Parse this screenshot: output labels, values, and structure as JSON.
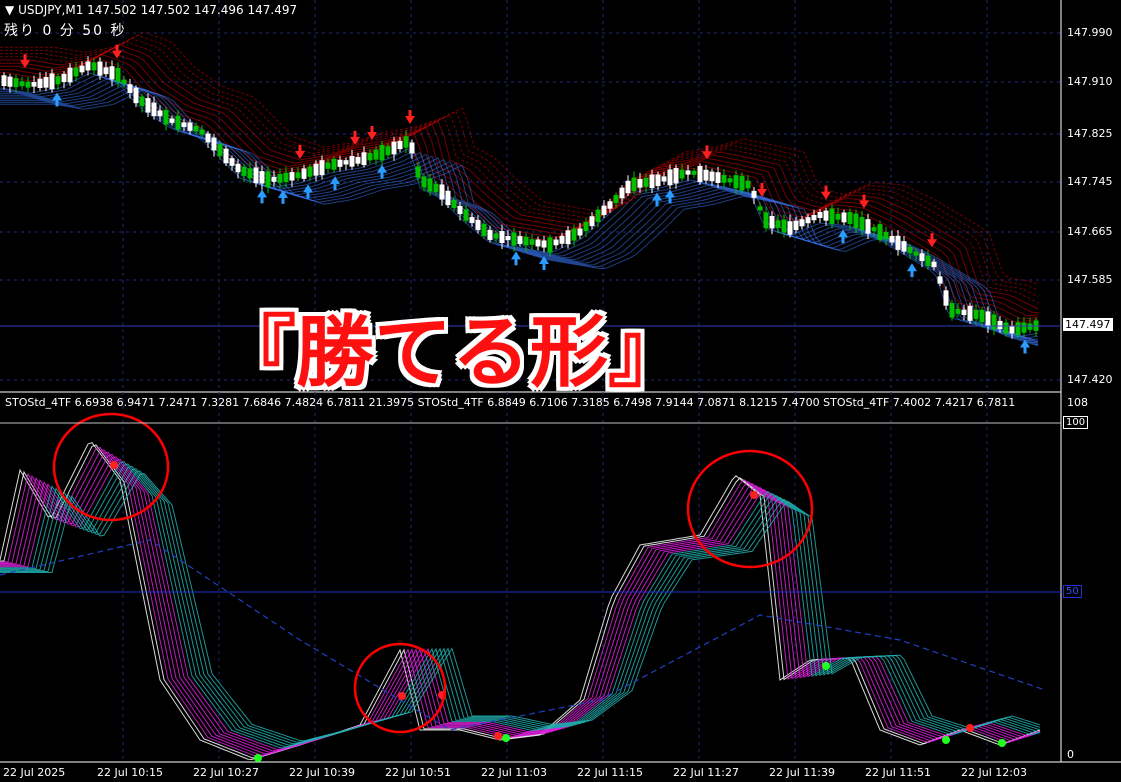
{
  "header": {
    "symbol_line": "USDJPY,M1  147.502 147.502 147.496 147.497",
    "countdown": "残り 0 分 50 秒"
  },
  "overlay": {
    "title": "『勝てる形』"
  },
  "indicator": {
    "header": "STOStd_4TF 6.6938 6.9471 7.2471 7.3281 7.6846 7.4824 6.7811 21.3975  STOStd_4TF 6.8849 6.7106 7.3185 6.7498 7.9144 7.0871 8.1215 7.4700  STOStd_4TF 7.4002 7.4217 6.7811",
    "scale_top": "108",
    "scale_100": "100",
    "scale_50": "50",
    "scale_0": "0"
  },
  "price_axis": [
    "147.990",
    "147.910",
    "147.825",
    "147.745",
    "147.665",
    "147.585",
    "147.420"
  ],
  "current_price": "147.497",
  "time_axis": [
    "22 Jul 2025",
    "22 Jul 10:15",
    "22 Jul 10:27",
    "22 Jul 10:39",
    "22 Jul 10:51",
    "22 Jul 11:03",
    "22 Jul 11:15",
    "22 Jul 11:27",
    "22 Jul 11:39",
    "22 Jul 11:51",
    "22 Jul 12:03"
  ],
  "colors": {
    "background": "#000000",
    "grid": "#1e2a7a",
    "bull_candle": "#00c000",
    "bear_candle": "#ffffff",
    "band_red": "#d00000",
    "band_blue": "#3a7cff",
    "sto_magenta": "#e020e0",
    "sto_cyan": "#20b0b0",
    "circle": "#ff0000",
    "current_price_box": "#ffffff"
  }
}
